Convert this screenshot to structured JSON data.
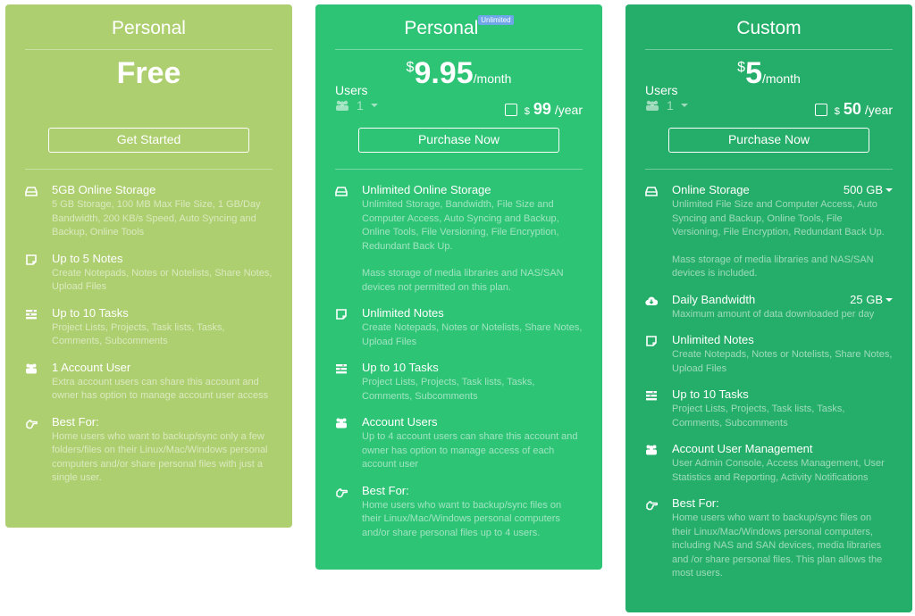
{
  "plans": [
    {
      "title": "Personal",
      "price_text": "Free",
      "button": "Get Started",
      "color": "#aecf70",
      "features": [
        {
          "icon": "hdd-icon",
          "title": "5GB Online Storage",
          "desc": [
            "5 GB Storage, 100 MB Max File Size, 1 GB/Day Bandwidth, 200 KB/s Speed, Auto Syncing and Backup, Online Tools"
          ]
        },
        {
          "icon": "note-icon",
          "title": "Up to 5 Notes",
          "desc": [
            "Create Notepads, Notes or Notelists, Share Notes, Upload Files"
          ]
        },
        {
          "icon": "tasks-icon",
          "title": "Up to 10 Tasks",
          "desc": [
            "Project Lists, Projects, Task lists, Tasks, Comments, Subcomments"
          ]
        },
        {
          "icon": "users-icon",
          "title": "1 Account User",
          "desc": [
            "Extra account users can share this account and owner has option to manage account user access"
          ]
        },
        {
          "icon": "hand-point-icon",
          "title": "Best For:",
          "desc": [
            "Home users who want to backup/sync only a few folders/files on their Linux/Mac/Windows personal computers and/or share personal files with just a single user."
          ]
        }
      ]
    },
    {
      "title": "Personal",
      "badge": "Unlimited",
      "currency": "$",
      "price": "9.95",
      "period": "/month",
      "users_label": "Users",
      "users_value": "1",
      "yearly_currency": "$",
      "yearly_price": "99",
      "yearly_period": " /year",
      "yearly_checked": false,
      "button": "Purchase Now",
      "color": "#2dc475",
      "features": [
        {
          "icon": "hdd-icon",
          "title": "Unlimited Online Storage",
          "desc": [
            "Unlimited Storage, Bandwidth, File Size and Computer Access, Auto Syncing and Backup, Online Tools, File Versioning, File Encryption, Redundant Back Up.",
            "Mass storage of media libraries and NAS/SAN devices not permitted on this plan."
          ]
        },
        {
          "icon": "note-icon",
          "title": "Unlimited Notes",
          "desc": [
            "Create Notepads, Notes or Notelists, Share Notes, Upload Files"
          ]
        },
        {
          "icon": "tasks-icon",
          "title": "Up to 10 Tasks",
          "desc": [
            "Project Lists, Projects, Task lists, Tasks, Comments, Subcomments"
          ]
        },
        {
          "icon": "users-icon",
          "title": "Account Users",
          "desc": [
            "Up to 4 account users can share this account and owner has option to manage access of each account user"
          ]
        },
        {
          "icon": "hand-point-icon",
          "title": "Best For:",
          "desc": [
            "Home users who want to backup/sync files on their Linux/Mac/Windows personal computers and/or share personal files up to 4 users."
          ]
        }
      ]
    },
    {
      "title": "Custom",
      "currency": "$",
      "price": "5",
      "period": "/month",
      "users_label": "Users",
      "users_value": "1",
      "yearly_currency": "$",
      "yearly_price": "50",
      "yearly_period": "/year",
      "yearly_checked": false,
      "button": "Purchase Now",
      "color": "#25ae69",
      "features": [
        {
          "icon": "hdd-icon",
          "title": "Online Storage",
          "value": "500 GB",
          "desc": [
            "Unlimited File Size and Computer Access, Auto Syncing and Backup, Online Tools, File Versioning, File Encryption, Redundant Back Up.",
            "Mass storage of media libraries and NAS/SAN devices is included."
          ]
        },
        {
          "icon": "cloud-download-icon",
          "title": "Daily Bandwidth",
          "value": "25 GB",
          "desc": [
            "Maximum amount of data downloaded per day"
          ]
        },
        {
          "icon": "note-icon",
          "title": "Unlimited Notes",
          "desc": [
            "Create Notepads, Notes or Notelists, Share Notes, Upload Files"
          ]
        },
        {
          "icon": "tasks-icon",
          "title": "Up to 10 Tasks",
          "desc": [
            "Project Lists, Projects, Task lists, Tasks, Comments, Subcomments"
          ]
        },
        {
          "icon": "users-icon",
          "title": "Account User Management",
          "desc": [
            "User Admin Console, Access Management, User Statistics and Reporting, Activity Notifications"
          ]
        },
        {
          "icon": "hand-point-icon",
          "title": "Best For:",
          "desc": [
            "Home users who want to backup/sync files on their Linux/Mac/Windows personal computers, including NAS and SAN devices, media libraries and /or share personal files. This plan allows the most users."
          ]
        }
      ]
    }
  ]
}
